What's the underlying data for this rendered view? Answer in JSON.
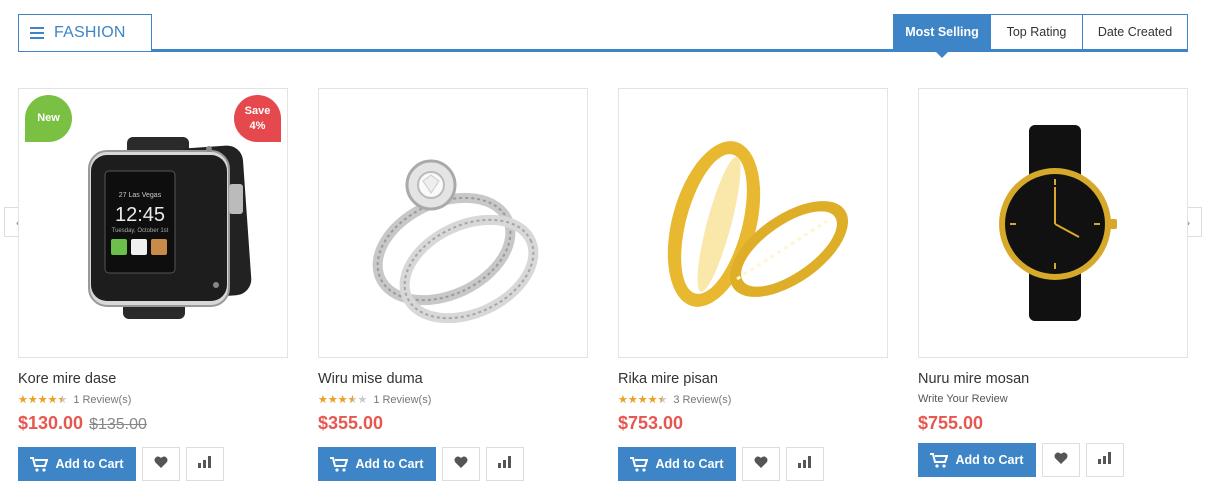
{
  "category": {
    "title": "FASHION",
    "icon": "menu-icon"
  },
  "tabs": [
    {
      "label": "Most Selling",
      "active": true
    },
    {
      "label": "Top Rating",
      "active": false
    },
    {
      "label": "Date Created",
      "active": false
    }
  ],
  "carousel": {
    "prev_icon": "chevron-left-icon",
    "prev_glyph": "‹",
    "next_icon": "chevron-right-icon",
    "next_glyph": "›"
  },
  "colors": {
    "accent": "#3d85c6",
    "price": "#e8574f",
    "badge_new": "#7ac143",
    "badge_sale": "#e5484d",
    "star": "#f0a020"
  },
  "products": [
    {
      "name": "Kore mire dase",
      "image": "smartwatch-image",
      "badge_new": "New",
      "badge_sale_line1": "Save",
      "badge_sale_line2": "4%",
      "rating": 4.5,
      "reviews": "1 Review(s)",
      "price": "$130.00",
      "old_price": "$135.00",
      "cart_label": "Add to Cart"
    },
    {
      "name": "Wiru mise duma",
      "image": "diamond-rings-image",
      "rating": 3.5,
      "reviews": "1 Review(s)",
      "price": "$355.00",
      "cart_label": "Add to Cart"
    },
    {
      "name": "Rika mire pisan",
      "image": "gold-rings-image",
      "rating": 4.5,
      "reviews": "3 Review(s)",
      "price": "$753.00",
      "cart_label": "Add to Cart"
    },
    {
      "name": "Nuru mire mosan",
      "image": "gold-watch-image",
      "write_review": "Write Your Review",
      "price": "$755.00",
      "cart_label": "Add to Cart"
    }
  ]
}
